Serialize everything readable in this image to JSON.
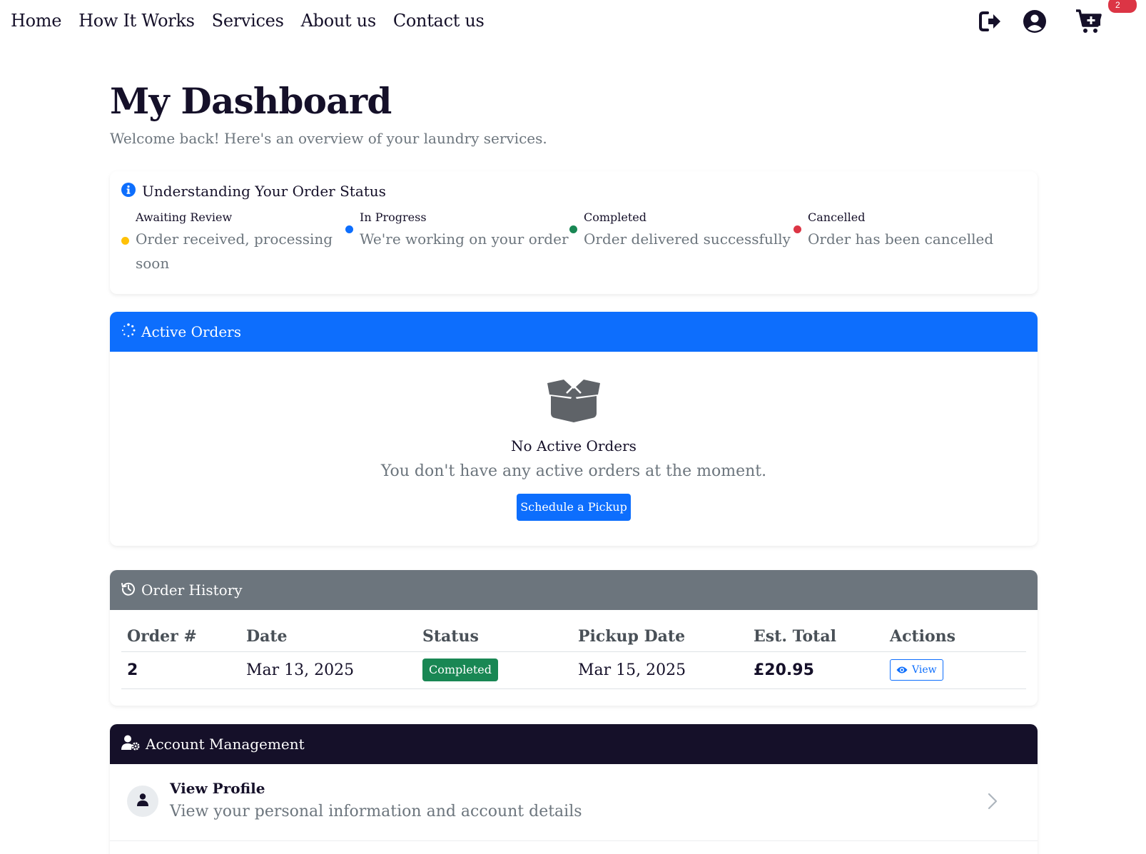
{
  "nav": {
    "links": [
      "Home",
      "How It Works",
      "Services",
      "About us",
      "Contact us"
    ],
    "cart_count": "2"
  },
  "page": {
    "title": "My Dashboard",
    "subtitle": "Welcome back! Here's an overview of your laundry services."
  },
  "status_legend": {
    "title": "Understanding Your Order Status",
    "items": [
      {
        "label": "Awaiting Review",
        "desc": "Order received, processing soon",
        "color": "#ffc107"
      },
      {
        "label": "In Progress",
        "desc": "We're working on your order",
        "color": "#0d6efd"
      },
      {
        "label": "Completed",
        "desc": "Order delivered successfully",
        "color": "#198754"
      },
      {
        "label": "Cancelled",
        "desc": "Order has been cancelled",
        "color": "#dc3545"
      }
    ]
  },
  "active_orders": {
    "title": "Active Orders",
    "header_color": "#0d6efd",
    "empty_title": "No Active Orders",
    "empty_desc": "You don't have any active orders at the moment.",
    "schedule_label": "Schedule a Pickup"
  },
  "order_history": {
    "title": "Order History",
    "header_color": "#6c757d",
    "columns": [
      "Order #",
      "Date",
      "Status",
      "Pickup Date",
      "Est. Total",
      "Actions"
    ],
    "rows": [
      {
        "order": "2",
        "date": "Mar 13, 2025",
        "status": "Completed",
        "pickup": "Mar 15, 2025",
        "total": "£20.95",
        "action": "View"
      }
    ]
  },
  "account": {
    "title": "Account Management",
    "header_color": "#151029",
    "items": [
      {
        "title": "View Profile",
        "desc": "View your personal information and account details"
      }
    ]
  }
}
